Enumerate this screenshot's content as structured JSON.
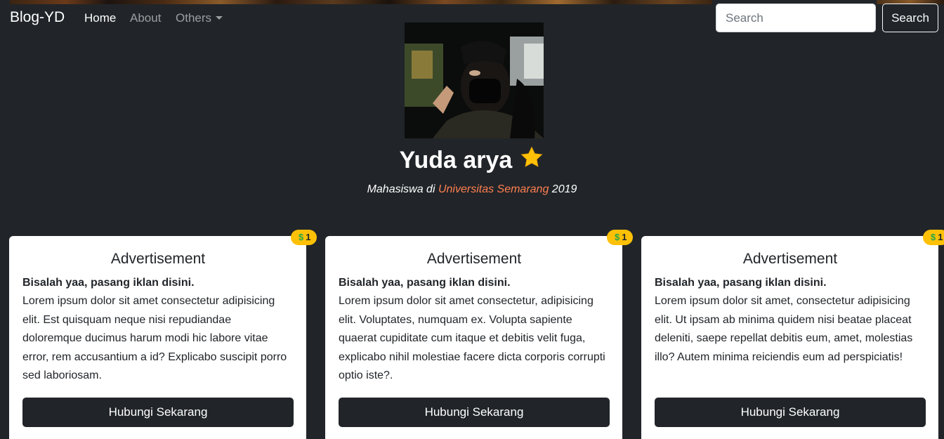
{
  "navbar": {
    "brand": "Blog-YD",
    "items": [
      {
        "label": "Home"
      },
      {
        "label": "About"
      },
      {
        "label": "Others"
      }
    ],
    "search_placeholder": "Search",
    "search_button": "Search"
  },
  "profile": {
    "name": "Yuda arya",
    "subtitle_prefix": "Mahasiswa di ",
    "university": "Universitas Semarang",
    "subtitle_suffix": " 2019",
    "star_icon": "star-icon"
  },
  "colors": {
    "background": "#212529",
    "link_accent": "#ff7f50",
    "badge": "#ffc107",
    "star": "#ffc107"
  },
  "cards": [
    {
      "badge": "1",
      "title": "Advertisement",
      "lead": "Bisalah yaa, pasang iklan disini.",
      "text": "Lorem ipsum dolor sit amet consectetur adipisicing elit. Est quisquam neque nisi repudiandae doloremque ducimus harum modi hic labore vitae error, rem accusantium a id? Explicabo suscipit porro sed laboriosam.",
      "button": "Hubungi Sekarang"
    },
    {
      "badge": "1",
      "title": "Advertisement",
      "lead": "Bisalah yaa, pasang iklan disini.",
      "text": "Lorem ipsum dolor sit amet consectetur, adipisicing elit. Voluptates, numquam ex. Volupta sapiente quaerat cupiditate cum itaque et debitis velit fuga, explicabo nihil molestiae facere dicta corporis corrupti optio iste?.",
      "button": "Hubungi Sekarang"
    },
    {
      "badge": "1",
      "title": "Advertisement",
      "lead": "Bisalah yaa, pasang iklan disini.",
      "text": "Lorem ipsum dolor sit amet, consectetur adipisicing elit. Ut ipsam ab minima quidem nisi beatae placeat deleniti, saepe repellat debitis eum, amet, molestias illo? Autem minima reiciendis eum ad perspiciatis!",
      "button": "Hubungi Sekarang"
    }
  ]
}
